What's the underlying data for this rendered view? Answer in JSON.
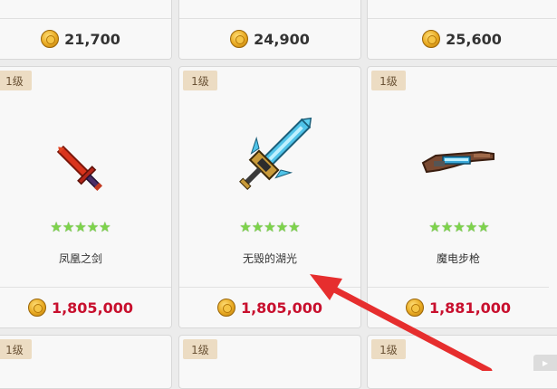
{
  "top_row": [
    {
      "price": "21,700"
    },
    {
      "price": "24,900"
    },
    {
      "price": "25,600"
    }
  ],
  "items": [
    {
      "level": "1级",
      "name": "凤凰之剑",
      "price": "1,805,000",
      "stars": "★★★★★",
      "icon": "phoenix-sword-icon"
    },
    {
      "level": "1级",
      "name": "无毁的湖光",
      "price": "1,805,000",
      "stars": "★★★★★",
      "icon": "lake-light-sword-icon"
    },
    {
      "level": "1级",
      "name": "魔电步枪",
      "price": "1,881,000",
      "stars": "★★★★★",
      "icon": "magic-rifle-icon"
    }
  ],
  "bottom_row": [
    {
      "level": "1级"
    },
    {
      "level": "1级"
    },
    {
      "level": "1级"
    }
  ],
  "colors": {
    "price_red": "#c8102e",
    "star_green": "#7dd34a",
    "level_bg": "#ecdcc3",
    "arrow_red": "#e62e2e"
  }
}
